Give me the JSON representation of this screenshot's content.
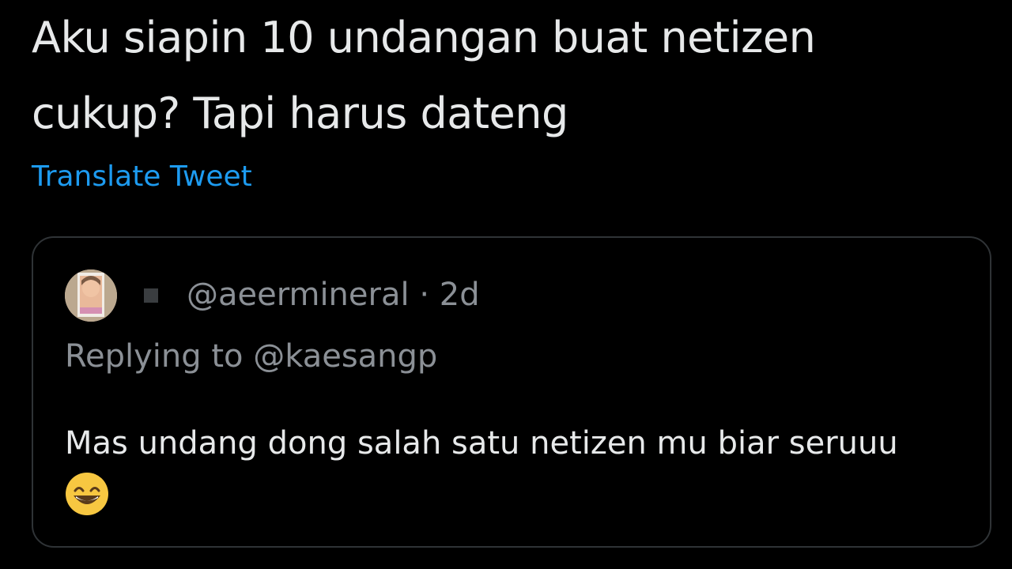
{
  "tweet": {
    "text_line_1": "Aku siapin 10 undangan buat netizen",
    "text_line_2": "cukup? Tapi harus dateng",
    "translate_label": "Translate Tweet"
  },
  "quoted_tweet": {
    "handle": "@aeermineral",
    "separator": "·",
    "time": "2d",
    "replying_prefix": "Replying to",
    "replying_to": "@kaesangp",
    "body": "Mas undang dong salah satu netizen mu biar seruuu",
    "emoji_icon": "grinning-face-with-smiling-eyes-icon"
  },
  "colors": {
    "background": "#000000",
    "primary_text": "#e7e9ea",
    "secondary_text": "#8b9096",
    "link": "#1d9bf0",
    "border": "#2f3336"
  }
}
